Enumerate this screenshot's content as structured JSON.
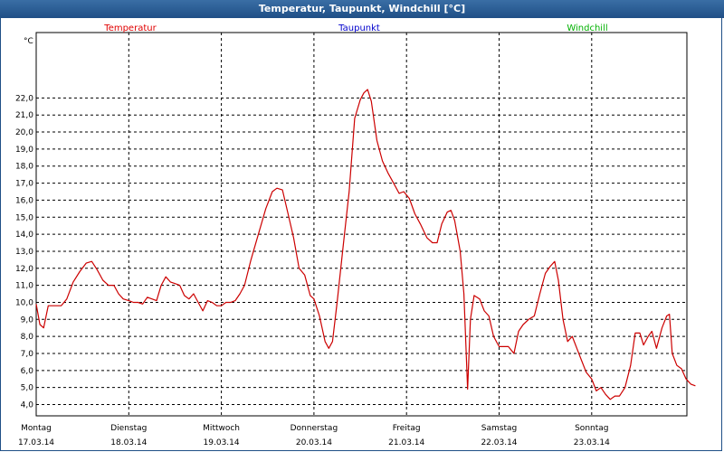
{
  "window": {
    "title": "Temperatur, Taupunkt, Windchill [°C]"
  },
  "chart_data": {
    "type": "line",
    "title": "Temperatur, Taupunkt, Windchill [°C]",
    "ylabel": "°C",
    "ylim": [
      3.5,
      23.5
    ],
    "yticks": [
      4.0,
      5.0,
      6.0,
      7.0,
      8.0,
      9.0,
      10.0,
      11.0,
      12.0,
      13.0,
      14.0,
      15.0,
      16.0,
      17.0,
      18.0,
      19.0,
      20.0,
      21.0,
      22.0
    ],
    "ytick_labels": [
      "4,0",
      "5,0",
      "6,0",
      "7,0",
      "8,0",
      "9,0",
      "10,0",
      "11,0",
      "12,0",
      "13,0",
      "14,0",
      "15,0",
      "16,0",
      "17,0",
      "18,0",
      "19,0",
      "20,0",
      "21,0",
      "22,0"
    ],
    "xlim": [
      0,
      7
    ],
    "x_unit": "days from Montag 17.03.14 00:00",
    "grid": true,
    "day_labels": [
      {
        "day": "Montag",
        "date": "17.03.14"
      },
      {
        "day": "Dienstag",
        "date": "18.03.14"
      },
      {
        "day": "Mittwoch",
        "date": "19.03.14"
      },
      {
        "day": "Donnerstag",
        "date": "20.03.14"
      },
      {
        "day": "Freitag",
        "date": "21.03.14"
      },
      {
        "day": "Samstag",
        "date": "22.03.14"
      },
      {
        "day": "Sonntag",
        "date": "23.03.14"
      }
    ],
    "legend": [
      {
        "name": "Temperatur",
        "color": "#e00000"
      },
      {
        "name": "Taupunkt",
        "color": "#0000cc"
      },
      {
        "name": "Windchill",
        "color": "#00b000"
      }
    ],
    "series": [
      {
        "name": "Temperatur",
        "color": "#cc0000",
        "points": [
          [
            0.0,
            9.9
          ],
          [
            0.04,
            8.7
          ],
          [
            0.08,
            8.5
          ],
          [
            0.13,
            9.8
          ],
          [
            0.2,
            9.8
          ],
          [
            0.27,
            9.8
          ],
          [
            0.33,
            10.2
          ],
          [
            0.4,
            11.2
          ],
          [
            0.47,
            11.8
          ],
          [
            0.54,
            12.3
          ],
          [
            0.6,
            12.4
          ],
          [
            0.66,
            11.9
          ],
          [
            0.72,
            11.3
          ],
          [
            0.78,
            11.0
          ],
          [
            0.84,
            11.0
          ],
          [
            0.89,
            10.5
          ],
          [
            0.94,
            10.2
          ],
          [
            1.0,
            10.1
          ],
          [
            1.05,
            10.0
          ],
          [
            1.1,
            10.0
          ],
          [
            1.15,
            9.9
          ],
          [
            1.2,
            10.3
          ],
          [
            1.25,
            10.2
          ],
          [
            1.3,
            10.1
          ],
          [
            1.35,
            11.0
          ],
          [
            1.4,
            11.5
          ],
          [
            1.45,
            11.2
          ],
          [
            1.5,
            11.1
          ],
          [
            1.55,
            11.0
          ],
          [
            1.6,
            10.4
          ],
          [
            1.65,
            10.2
          ],
          [
            1.7,
            10.5
          ],
          [
            1.75,
            10.0
          ],
          [
            1.8,
            9.5
          ],
          [
            1.85,
            10.1
          ],
          [
            1.9,
            10.0
          ],
          [
            1.95,
            9.8
          ],
          [
            2.0,
            9.8
          ],
          [
            2.05,
            10.0
          ],
          [
            2.1,
            10.0
          ],
          [
            2.15,
            10.1
          ],
          [
            2.2,
            10.5
          ],
          [
            2.25,
            11.0
          ],
          [
            2.32,
            12.5
          ],
          [
            2.4,
            14.0
          ],
          [
            2.48,
            15.5
          ],
          [
            2.55,
            16.5
          ],
          [
            2.6,
            16.7
          ],
          [
            2.66,
            16.6
          ],
          [
            2.72,
            15.2
          ],
          [
            2.78,
            13.8
          ],
          [
            2.84,
            12.0
          ],
          [
            2.9,
            11.6
          ],
          [
            2.96,
            10.4
          ],
          [
            3.0,
            10.2
          ],
          [
            3.06,
            9.2
          ],
          [
            3.12,
            7.7
          ],
          [
            3.16,
            7.3
          ],
          [
            3.2,
            7.7
          ],
          [
            3.25,
            10.0
          ],
          [
            3.32,
            13.5
          ],
          [
            3.38,
            16.5
          ],
          [
            3.44,
            20.8
          ],
          [
            3.5,
            21.9
          ],
          [
            3.54,
            22.3
          ],
          [
            3.58,
            22.5
          ],
          [
            3.62,
            21.8
          ],
          [
            3.68,
            19.5
          ],
          [
            3.74,
            18.3
          ],
          [
            3.8,
            17.6
          ],
          [
            3.86,
            17.0
          ],
          [
            3.92,
            16.4
          ],
          [
            3.97,
            16.5
          ],
          [
            4.03,
            16.1
          ],
          [
            4.09,
            15.2
          ],
          [
            4.15,
            14.6
          ],
          [
            4.22,
            13.8
          ],
          [
            4.28,
            13.5
          ],
          [
            4.33,
            13.5
          ],
          [
            4.38,
            14.6
          ],
          [
            4.44,
            15.3
          ],
          [
            4.48,
            15.4
          ],
          [
            4.52,
            14.8
          ],
          [
            4.58,
            13.0
          ],
          [
            4.62,
            10.5
          ],
          [
            4.66,
            4.9
          ],
          [
            4.69,
            9.0
          ],
          [
            4.73,
            10.4
          ],
          [
            4.79,
            10.2
          ],
          [
            4.84,
            9.5
          ],
          [
            4.89,
            9.2
          ],
          [
            4.94,
            8.0
          ],
          [
            5.0,
            7.4
          ],
          [
            5.05,
            7.4
          ],
          [
            5.1,
            7.4
          ],
          [
            5.16,
            7.0
          ],
          [
            5.21,
            8.3
          ],
          [
            5.26,
            8.7
          ],
          [
            5.32,
            9.0
          ],
          [
            5.38,
            9.2
          ],
          [
            5.44,
            10.5
          ],
          [
            5.5,
            11.7
          ],
          [
            5.55,
            12.1
          ],
          [
            5.6,
            12.4
          ],
          [
            5.64,
            11.3
          ],
          [
            5.69,
            9.0
          ],
          [
            5.74,
            7.7
          ],
          [
            5.79,
            8.0
          ],
          [
            5.84,
            7.3
          ],
          [
            5.89,
            6.6
          ],
          [
            5.94,
            5.9
          ],
          [
            6.0,
            5.5
          ],
          [
            6.05,
            4.8
          ],
          [
            6.1,
            5.0
          ],
          [
            6.15,
            4.6
          ],
          [
            6.2,
            4.3
          ],
          [
            6.25,
            4.5
          ],
          [
            6.3,
            4.5
          ],
          [
            6.36,
            5.0
          ],
          [
            6.42,
            6.3
          ],
          [
            6.47,
            8.2
          ],
          [
            6.52,
            8.2
          ],
          [
            6.56,
            7.5
          ],
          [
            6.61,
            8.0
          ],
          [
            6.65,
            8.3
          ],
          [
            6.7,
            7.3
          ],
          [
            6.76,
            8.5
          ],
          [
            6.81,
            9.2
          ],
          [
            6.84,
            9.3
          ],
          [
            6.87,
            7.0
          ],
          [
            6.92,
            6.3
          ],
          [
            6.97,
            6.1
          ],
          [
            7.02,
            5.5
          ],
          [
            7.07,
            5.2
          ],
          [
            7.12,
            5.1
          ]
        ]
      }
    ]
  }
}
